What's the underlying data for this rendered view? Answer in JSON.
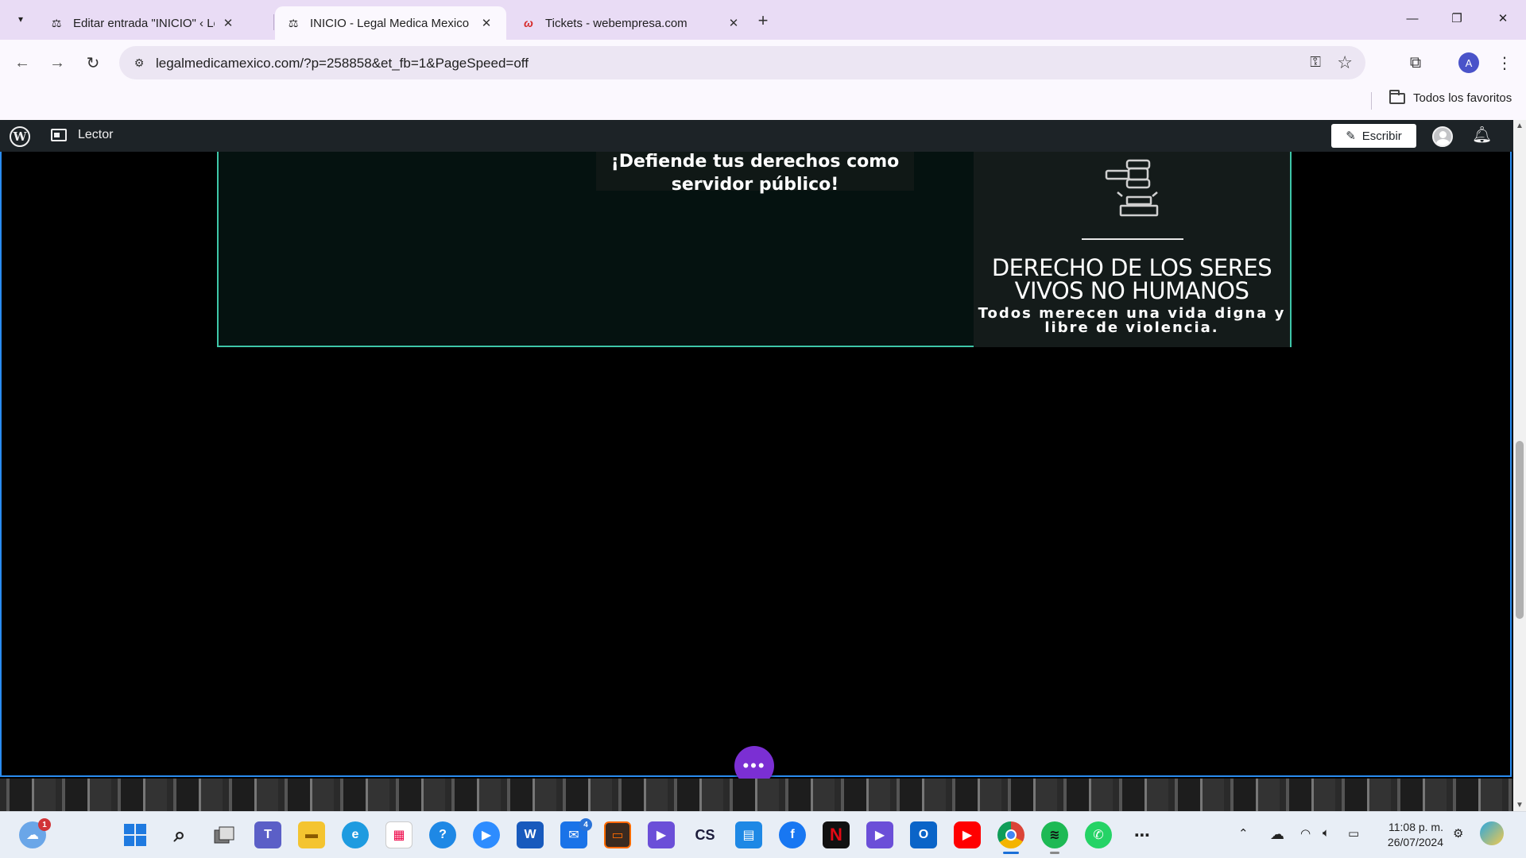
{
  "browser": {
    "tabs": [
      {
        "title": "Editar entrada \"INICIO\" ‹ Legal M",
        "favicon": "scale-icon",
        "active": false
      },
      {
        "title": "INICIO - Legal Medica Mexico",
        "favicon": "scale-icon",
        "active": true
      },
      {
        "title": "Tickets - webempresa.com",
        "favicon": "webempresa-icon",
        "active": false
      }
    ],
    "url": "legalmedicamexico.com/?p=258858&et_fb=1&PageSpeed=off",
    "profile_initial": "A",
    "bookmarks": {
      "all_favorites": "Todos los favoritos"
    }
  },
  "wp_admin_bar": {
    "reader_label": "Lector",
    "write_label": "Escribir"
  },
  "page": {
    "cta_text": "¡Defiende tus derechos como servidor público!",
    "card": {
      "title": "DERECHO DE LOS SERES VIVOS NO HUMANOS",
      "text": "Todos merecen  una vida digna y libre de violencia."
    },
    "fab_label": "•••"
  },
  "taskbar": {
    "weather_badge": "1",
    "mail_badge": "4",
    "clock_time": "11:08 p. m.",
    "clock_date": "26/07/2024",
    "apps": [
      "weather",
      "start",
      "search",
      "task-view",
      "teams",
      "file-explorer",
      "edge",
      "store",
      "help",
      "zoom",
      "word",
      "mail",
      "app-orange",
      "app-purple",
      "cs",
      "calculator",
      "facebook",
      "netflix",
      "app-purple-2",
      "outlook",
      "youtube",
      "chrome",
      "spotify",
      "whatsapp",
      "more"
    ]
  },
  "colors": {
    "accent_border": "#3ec6a8",
    "edit_frame": "#2a8cf0",
    "fab": "#7b2fd3",
    "tabstrip": "#e9dcf5"
  }
}
